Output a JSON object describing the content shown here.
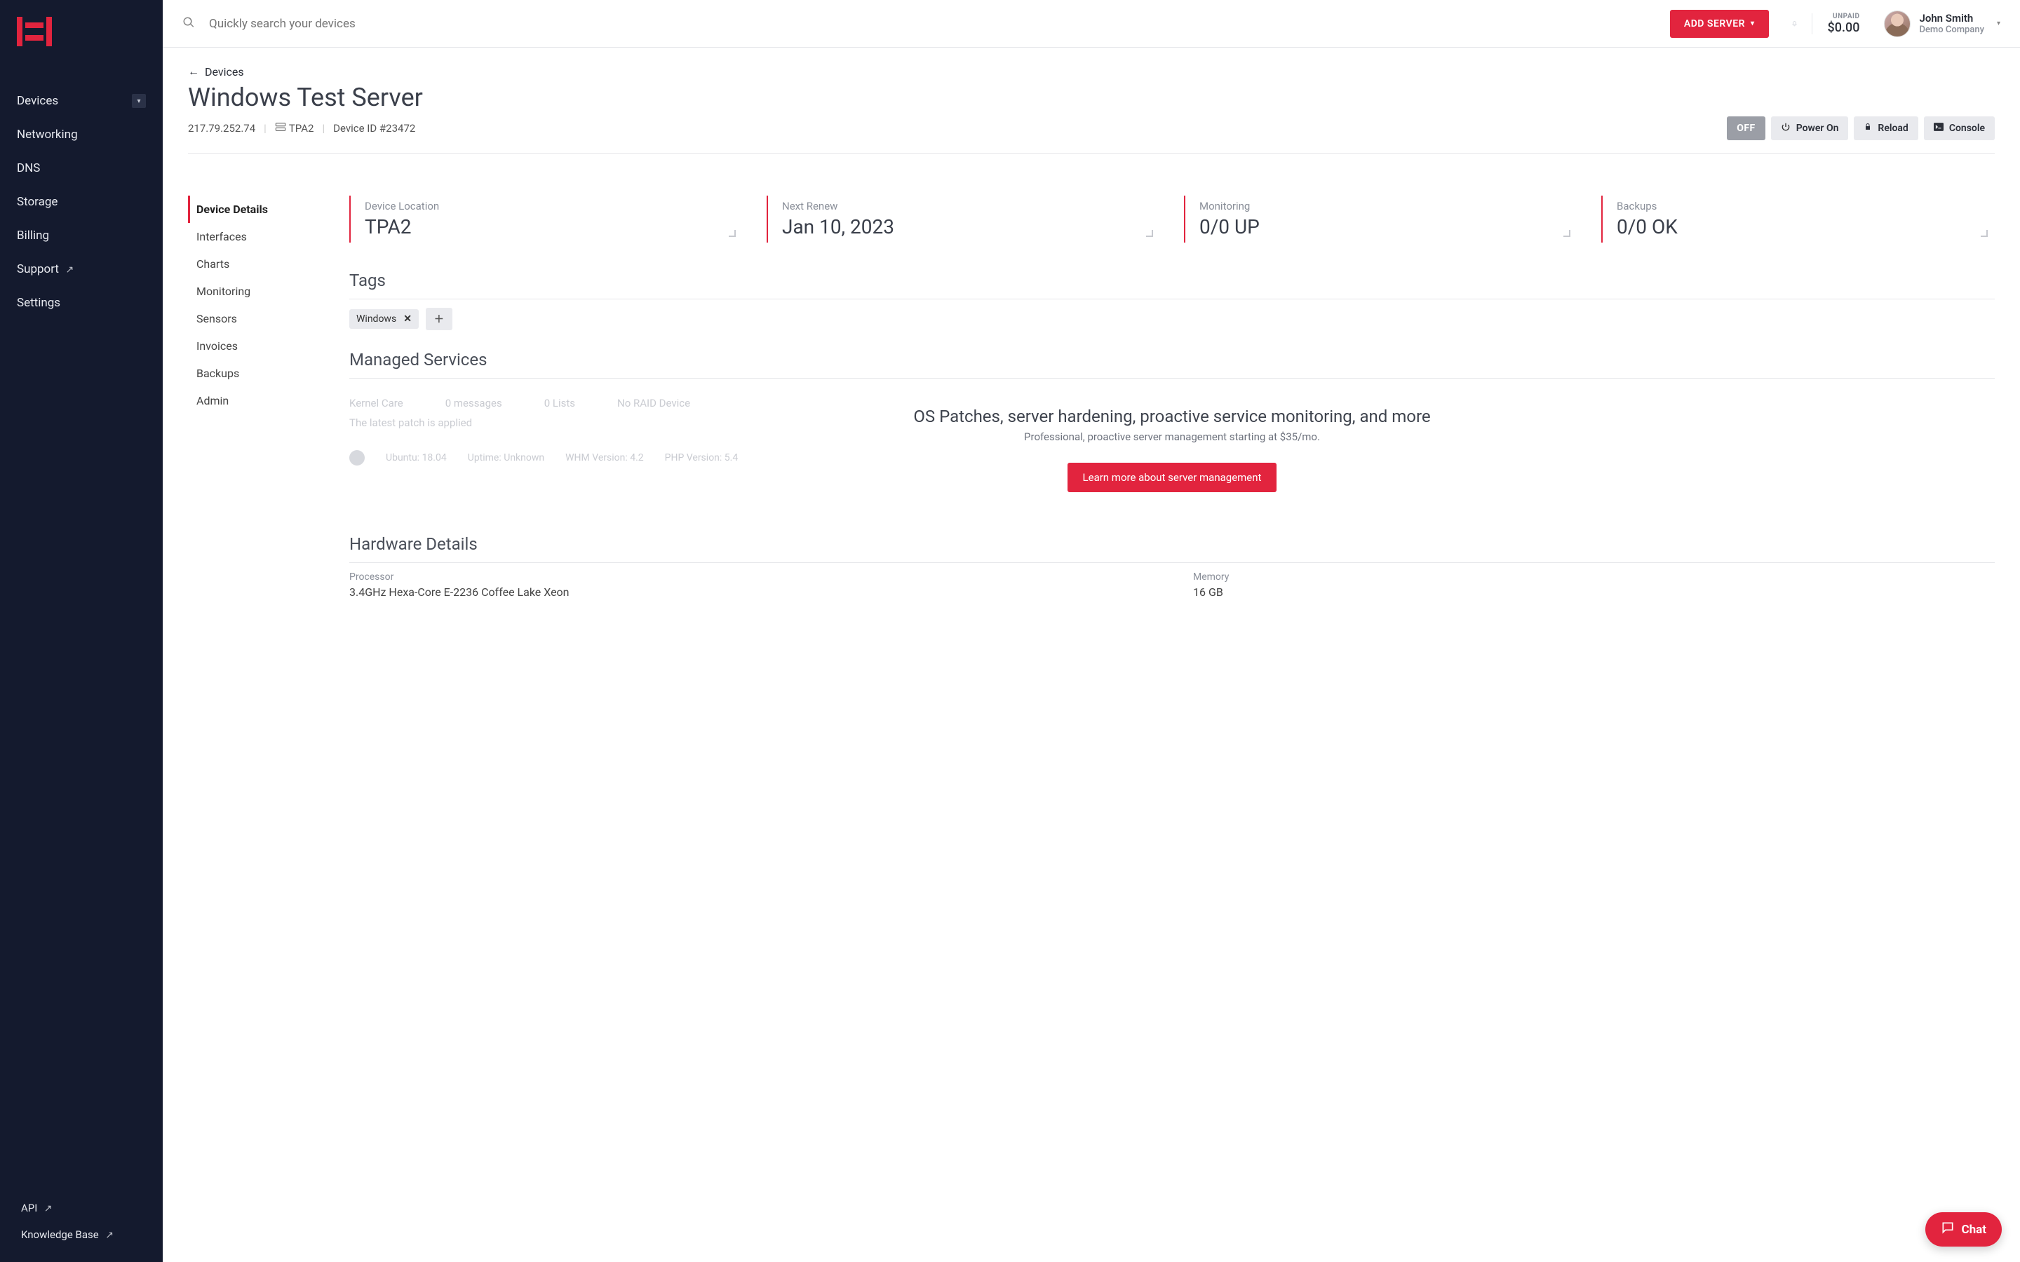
{
  "sidebar": {
    "items": [
      {
        "label": "Devices",
        "expandable": true
      },
      {
        "label": "Networking"
      },
      {
        "label": "DNS"
      },
      {
        "label": "Storage"
      },
      {
        "label": "Billing"
      },
      {
        "label": "Support",
        "external": true
      },
      {
        "label": "Settings"
      }
    ],
    "bottom": [
      {
        "label": "API",
        "external": true
      },
      {
        "label": "Knowledge Base",
        "external": true
      }
    ]
  },
  "topbar": {
    "search_placeholder": "Quickly search your devices",
    "add_server": "ADD SERVER",
    "unpaid_label": "UNPAID",
    "unpaid_value": "$0.00",
    "user_name": "John Smith",
    "user_company": "Demo Company"
  },
  "page": {
    "back_label": "Devices",
    "title": "Windows Test Server",
    "ip": "217.79.252.74",
    "location_code": "TPA2",
    "device_id": "Device ID #23472",
    "actions": {
      "off": "OFF",
      "power": "Power On",
      "reload": "Reload",
      "console": "Console"
    },
    "subnav": [
      "Device Details",
      "Interfaces",
      "Charts",
      "Monitoring",
      "Sensors",
      "Invoices",
      "Backups",
      "Admin"
    ],
    "stats": [
      {
        "label": "Device Location",
        "value": "TPA2"
      },
      {
        "label": "Next Renew",
        "value": "Jan 10, 2023"
      },
      {
        "label": "Monitoring",
        "value": "0/0 UP"
      },
      {
        "label": "Backups",
        "value": "0/0 OK"
      }
    ],
    "tags_heading": "Tags",
    "tags": [
      "Windows"
    ],
    "managed": {
      "heading": "Managed Services",
      "overlay_title": "OS Patches, server hardening, proactive service monitoring, and more",
      "overlay_sub": "Professional, proactive server management starting at $35/mo.",
      "cta": "Learn more about server management",
      "under_kernel": "Kernel Care",
      "under_patch": "The latest patch is applied",
      "under_messages": "0 messages",
      "under_lists": "0 Lists",
      "under_raid": "No RAID Device",
      "under_os_label": "Ubuntu:",
      "under_os_ver": "18.04",
      "under_uptime_label": "Uptime:",
      "under_uptime_val": "Unknown",
      "under_whm_label": "WHM Version:",
      "under_whm_val": "4.2",
      "under_php_label": "PHP Version:",
      "under_php_val": "5.4"
    },
    "hardware": {
      "heading": "Hardware Details",
      "processor_label": "Processor",
      "processor_value": "3.4GHz Hexa-Core E-2236 Coffee Lake Xeon",
      "memory_label": "Memory",
      "memory_value": "16 GB"
    }
  },
  "chat_label": "Chat"
}
